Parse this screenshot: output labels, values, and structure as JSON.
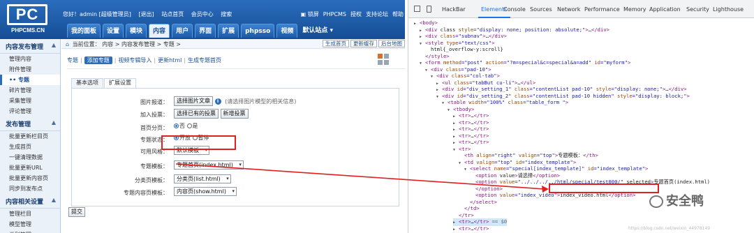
{
  "cms": {
    "logo": {
      "mark": "PC",
      "sub": "PHPCMS.CN"
    },
    "topbar": {
      "greeting": "您好！admin [超级管理员]",
      "logout": "[退出]",
      "site_home": "站点首页",
      "member_center": "会员中心",
      "search": "搜索"
    },
    "toplinks": [
      "锁屏",
      "PHPCMS",
      "授权",
      "支持论坛",
      "帮助"
    ],
    "nav": [
      "我的面板",
      "设置",
      "模块",
      "内容",
      "用户",
      "界面",
      "扩展",
      "phpsso",
      "视频"
    ],
    "nav_active_index": 3,
    "site_point": "默认站点",
    "sidebar": {
      "groups": [
        {
          "title": "内容发布管理",
          "items": [
            "管理内容",
            "附件管理",
            "专题",
            "碎片管理",
            "采集管理",
            "评论管理"
          ]
        },
        {
          "title": "发布管理",
          "items": [
            "批量更新栏目页",
            "生成首页",
            "一键清理数据",
            "批量更新URL",
            "批量更新内容页",
            "同步到发布点"
          ]
        },
        {
          "title": "内容相关设置",
          "items": [
            "管理栏目",
            "模型管理",
            "类别管理"
          ]
        }
      ],
      "active_item": "专题",
      "active_prefix": "••"
    },
    "breadcrumb": {
      "label": "当前位置：",
      "path": "内容 > 内容发布管理 > 专题 >"
    },
    "crumb_actions": [
      "生成首页",
      "更新缓存",
      "后台地图"
    ],
    "subtabs": [
      "专题",
      "添加专题",
      "视频专辑导入",
      "更新html",
      "生成专题首页"
    ],
    "subtab_active_index": 1,
    "tabs": [
      "基本选项",
      "扩展设置"
    ],
    "tab_active_index": 1,
    "form": {
      "image_label": "图片报道：",
      "image_button": "选择图片文章",
      "image_hint": "(请选择图片模型的相关信息)",
      "vote_label": "加入投票：",
      "vote_button1": "选择已有的投票",
      "vote_button2": "新增投票",
      "paging_label": "首页分页：",
      "paging_no": "否",
      "paging_yes": "是",
      "status_label": "专题状态：",
      "status_open": "开放",
      "status_pause": "暂停",
      "style_label": "可用风格：",
      "style_value": "默认模板",
      "template_label": "专题模板：",
      "template_value": "专题首页(index.html)",
      "category_label": "分类页模板：",
      "category_value": "分类页(list.html)",
      "show_label": "专题内容页模板：",
      "show_value": "内容页(show.html)"
    },
    "submit": "提交"
  },
  "devtools": {
    "tabs": [
      "HackBar",
      "Elements",
      "Console",
      "Sources",
      "Network",
      "Performance",
      "Memory",
      "Application",
      "Security",
      "Lighthouse"
    ],
    "active_tab_index": 1,
    "lines": [
      "<body>",
      "<div class style=\"display: none; position: absolute;\">…</div>",
      "<div class=\"subnav\">…</div>",
      "<style type=\"text/css\">",
      "html{_overflow-y:scroll}",
      "</style>",
      "<form method=\"post\" action=\"?m=special&c=special&a=add\" id=\"myform\">",
      "<div class=\"pad-10\">",
      "<div class=\"col-tab\">",
      "<ul class=\"tabBut cu-li\">…</ul>",
      "<div id=\"div_setting_1\" class=\"contentList pad-10\" style=\"display: none;\">…</div>",
      "<div id=\"div_setting_2\" class=\"contentList pad-10 hidden\" style=\"display: block;\">",
      "<table width=\"100%\" class=\"table_form \">",
      "<tbody>",
      "<tr>…</tr>",
      "<tr>…</tr>",
      "<tr>…</tr>",
      "<tr>…</tr>",
      "<tr>…</tr>",
      "<tr>",
      "<th align=\"right\" valign=\"top\">专题模板：</th>",
      "<td valign=\"top\" id=\"index_template\">",
      "<select name=\"special[index_template]\" id=\"index_template\">",
      "<option value>请选择</option>",
      "<option value=\"../../../../html/special/test000/\" selected>专题首页(index.html)",
      "</option>",
      "<option value=\"index_video\">index_video.html</option>",
      "</select>",
      "</td>",
      "</tr>",
      "<tr>…</tr> == $0",
      "<tr>…</tr>"
    ]
  },
  "watermark": {
    "text": "安全鸭",
    "url": "https://blog.csdn.net/weixin_44978149"
  }
}
